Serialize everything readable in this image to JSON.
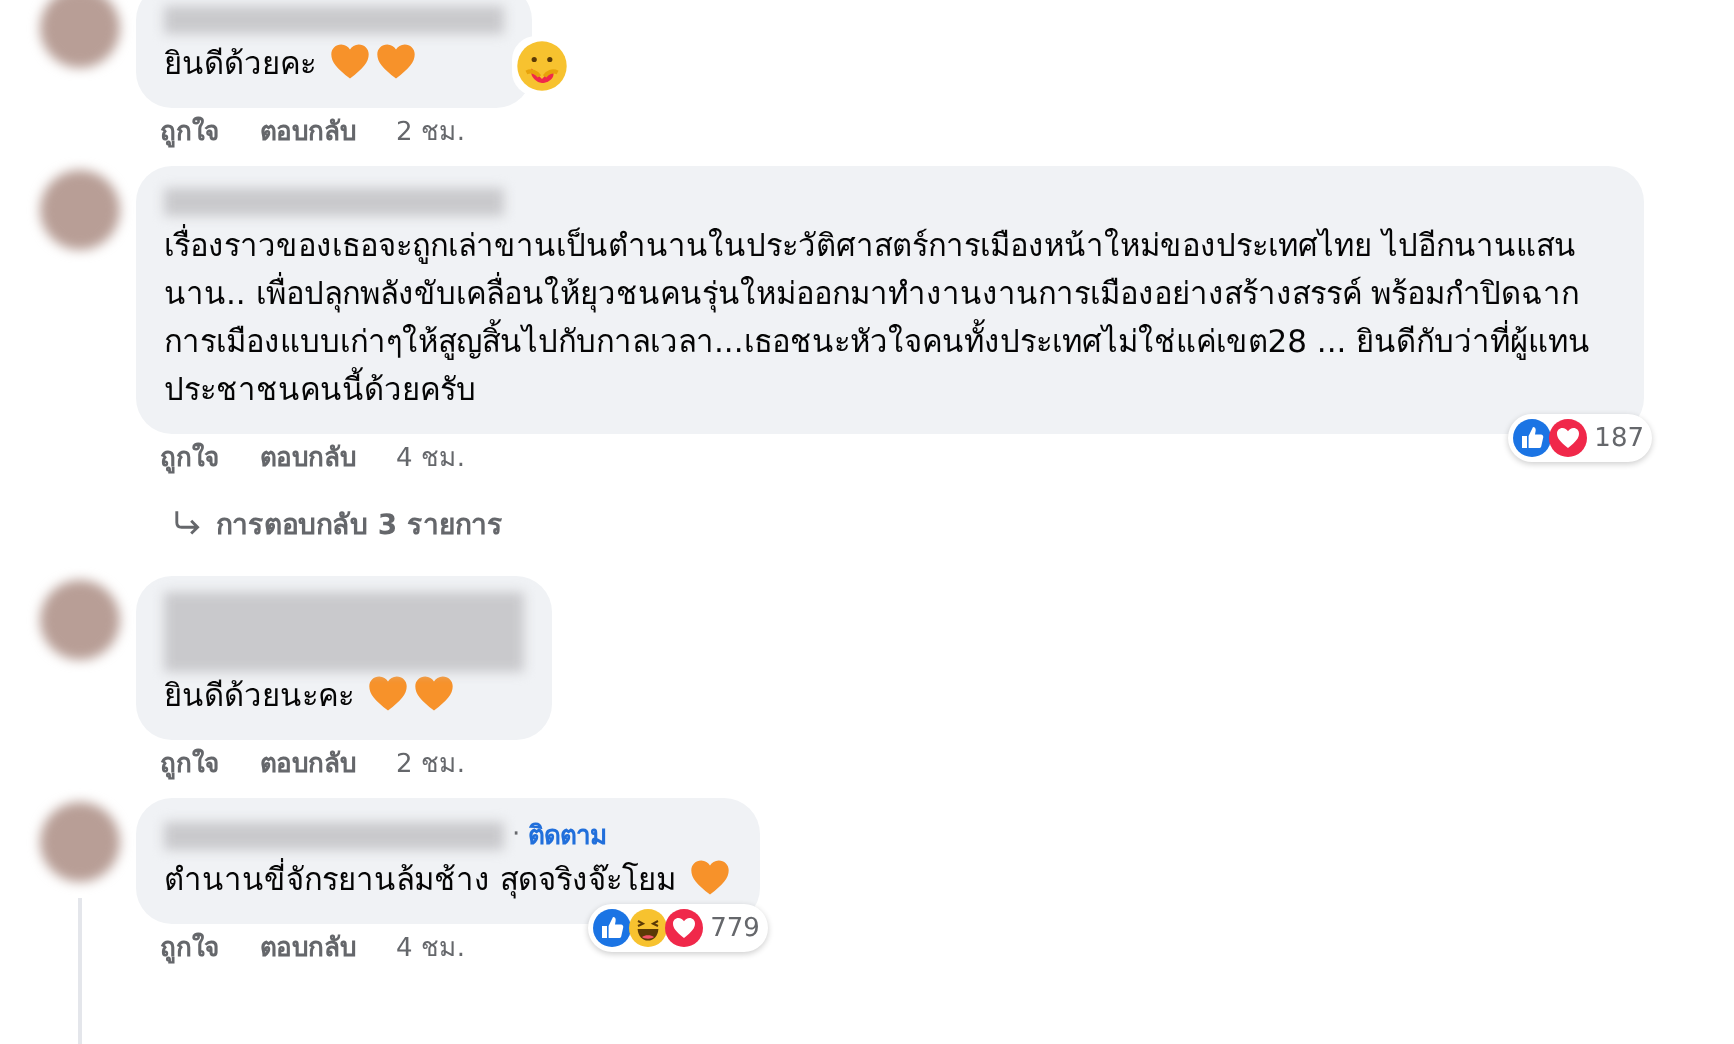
{
  "comments": [
    {
      "text": "ยินดีด้วยคะ",
      "emojis": [
        {
          "kind": "orange-heart"
        },
        {
          "kind": "orange-heart"
        }
      ],
      "reactions": [
        {
          "kind": "care"
        }
      ],
      "actions": [
        "ถูกใจ",
        "ตอบกลับ"
      ],
      "time": "2 ชม."
    },
    {
      "text": "เรื่องราวของเธอจะถูกเล่าขานเป็นตำนานในประวัติศาสตร์การเมืองหน้าใหม่ของประเทศไทย ไปอีกนานแสนนาน.. เพื่อปลุกพลังขับเคลื่อนให้ยุวชนคนรุ่นใหม่ออกมาทำงานงานการเมืองอย่างสร้างสรรค์ พร้อมกำปิดฉากการเมืองแบบเก่าๆให้สูญสิ้นไปกับกาลเวลา...เธอชนะหัวใจคนทั้งประเทศไม่ใช่แค่เขต28 ... ยินดีกับว่าที่ผู้แทนประชาชนคนนี้ด้วยครับ",
      "reactions": [
        {
          "kind": "like"
        },
        {
          "kind": "love"
        }
      ],
      "reaction_count": "187",
      "actions": [
        "ถูกใจ",
        "ตอบกลับ"
      ],
      "time": "4 ชม.",
      "replies_link": "การตอบกลับ 3 รายการ"
    },
    {
      "text": "ยินดีด้วยนะคะ",
      "emojis": [
        {
          "kind": "orange-heart"
        },
        {
          "kind": "orange-heart"
        }
      ],
      "actions": [
        "ถูกใจ",
        "ตอบกลับ"
      ],
      "time": "2 ชม."
    },
    {
      "text": "ตำนานขี่จักรยานล้มช้าง สุดจริงจ๊ะโยม",
      "emojis": [
        {
          "kind": "orange-heart"
        }
      ],
      "separator": "·",
      "follow": "ติดตาม",
      "reactions": [
        {
          "kind": "like"
        },
        {
          "kind": "haha"
        },
        {
          "kind": "love"
        }
      ],
      "reaction_count": "779",
      "actions": [
        "ถูกใจ",
        "ตอบกลับ"
      ],
      "time": "4 ชม.",
      "thread_line": true
    }
  ]
}
